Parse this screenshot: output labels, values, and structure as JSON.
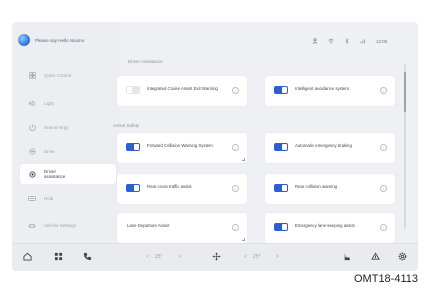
{
  "voice": {
    "text": "Please say Hello Nuomo"
  },
  "sidebar": {
    "items": [
      {
        "label": "Quick Control",
        "icon": "quick-control-icon"
      },
      {
        "label": "Light",
        "icon": "light-icon"
      },
      {
        "label": "New Energy",
        "icon": "new-energy-icon"
      },
      {
        "label": "Drive",
        "icon": "drive-icon"
      },
      {
        "label": "Driver assistance",
        "icon": "driver-assistance-icon",
        "active": true
      },
      {
        "label": "Hold",
        "icon": "hold-icon"
      },
      {
        "label": "Vehicle Settings",
        "icon": "vehicle-settings-icon"
      }
    ]
  },
  "status": {
    "time": "12:00"
  },
  "sections": {
    "top": "Driver Assistance",
    "active_safety": "Active Safety"
  },
  "cards": {
    "c1": {
      "label": "Integrated Cruise Assist Exit Warning",
      "on": false
    },
    "c2": {
      "label": "Intelligent avoidance system",
      "on": true
    },
    "c3": {
      "label": "Forward Collision Warning System",
      "on": true
    },
    "c4": {
      "label": "Automatic emergency braking",
      "on": true
    },
    "c5": {
      "label": "Rear cross traffic assist",
      "on": true
    },
    "c6": {
      "label": "Rear collision warning",
      "on": true
    },
    "c7": {
      "label": "Lane Departure Assist",
      "on": false
    },
    "c8": {
      "label": "Emergency lane-keeping assist",
      "on": true
    }
  },
  "climate": {
    "left_temp": "25°",
    "right_temp": "25°",
    "minus": "<",
    "plus": ">"
  },
  "caption": "OMT18-4113",
  "colors": {
    "accent": "#2f5fcc",
    "screen_bg": "#eef0f4",
    "card_bg": "#ffffff"
  }
}
